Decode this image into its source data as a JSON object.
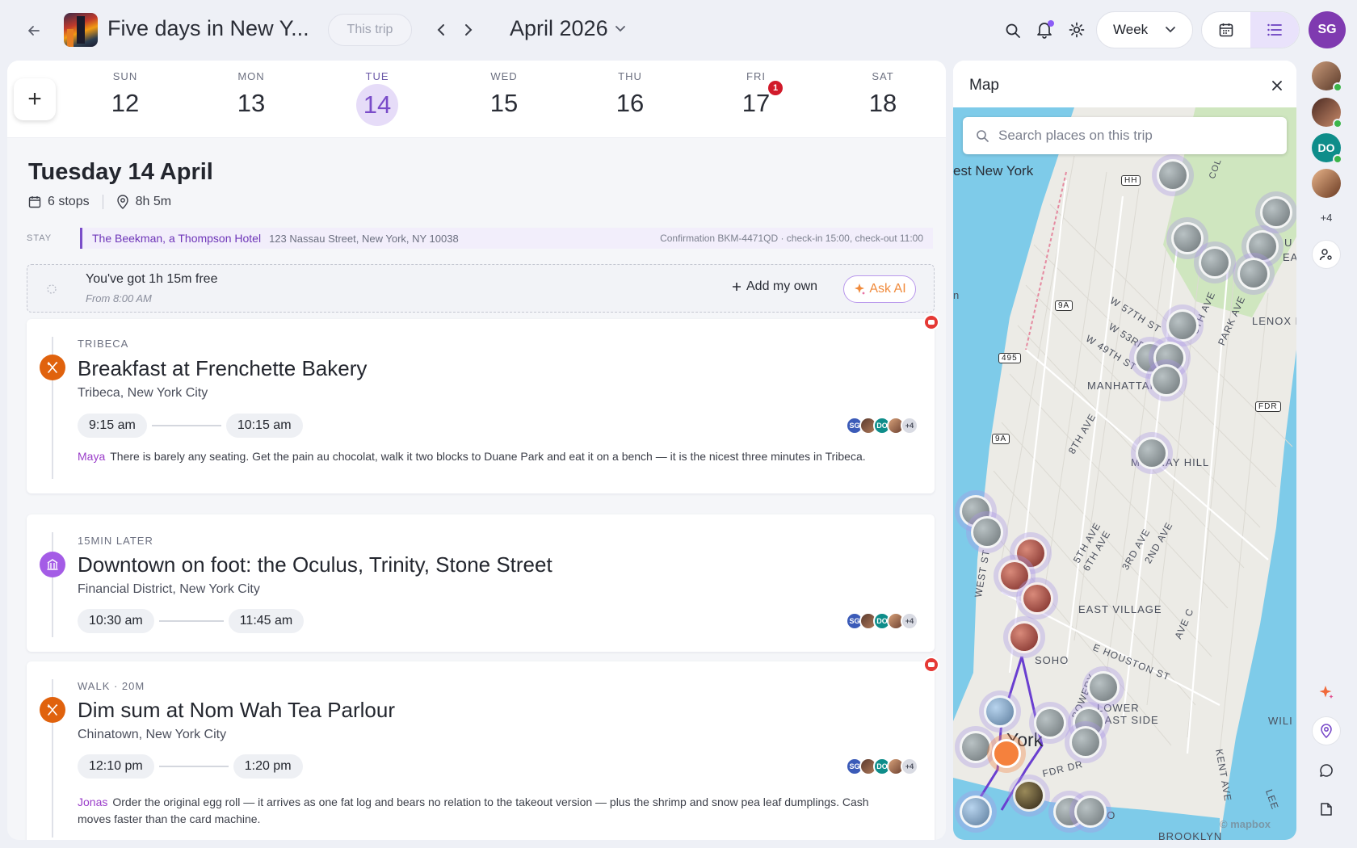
{
  "header": {
    "trip_title": "Five days in New Y...",
    "trip_filter": "This trip",
    "month": "April 2026",
    "view_mode": "Week",
    "user_initials": "SG"
  },
  "week": {
    "days": [
      {
        "dow": "SUN",
        "num": "12"
      },
      {
        "dow": "MON",
        "num": "13"
      },
      {
        "dow": "TUE",
        "num": "14",
        "active": true
      },
      {
        "dow": "WED",
        "num": "15"
      },
      {
        "dow": "THU",
        "num": "16"
      },
      {
        "dow": "FRI",
        "num": "17",
        "badge": "1"
      },
      {
        "dow": "SAT",
        "num": "18"
      }
    ]
  },
  "day": {
    "title": "Tuesday 14 April",
    "stops": "6 stops",
    "duration": "8h 5m"
  },
  "stay": {
    "label": "STAY",
    "name": "The Beekman, a Thompson Hotel",
    "address": "123 Nassau Street, New York, NY 10038",
    "confirmation": "Confirmation BKM-4471QD · check-in 15:00, check-out 11:00"
  },
  "free": {
    "title": "You've got 1h 15m free",
    "subtitle": "From 8:00 AM",
    "add_own": "Add my own",
    "ask_ai": "Ask AI"
  },
  "events": [
    {
      "eyebrow": "TRIBECA",
      "title": "Breakfast at Frenchette Bakery",
      "location": "Tribeca, New York City",
      "start": "9:15 am",
      "end": "10:15 am",
      "note_author": "Maya",
      "note": "There is barely any seating. Get the pain au chocolat, walk it two blocks to Duane Park and eat it on a bench — it is the nicest three minutes in Tribeca.",
      "icon": "fork-knife-icon",
      "icon_color": "#e0620d"
    },
    {
      "eyebrow": "15MIN LATER",
      "title": "Downtown on foot: the Oculus, Trinity, Stone Street",
      "location": "Financial District, New York City",
      "start": "10:30 am",
      "end": "11:45 am",
      "icon": "landmark-icon",
      "icon_color": "#a45ce6"
    },
    {
      "eyebrow": "WALK · 20M",
      "title": "Dim sum at Nom Wah Tea Parlour",
      "location": "Chinatown, New York City",
      "start": "12:10 pm",
      "end": "1:20 pm",
      "note_author": "Jonas",
      "note": "Order the original egg roll — it arrives as one fat log and bears no relation to the takeout version — plus the shrimp and snow pea leaf dumplings. Cash moves faster than the card machine.",
      "icon": "fork-knife-icon",
      "icon_color": "#e0620d"
    }
  ],
  "attendees": {
    "sg": "SG",
    "do": "DO",
    "more": "+4"
  },
  "map": {
    "title": "Map",
    "search_placeholder": "Search places on this trip",
    "labels": {
      "west_ny": "est New York",
      "manhattan": "MANHATTAN",
      "murray_hill": "MURRAY HILL",
      "east_village": "EAST VILLAGE",
      "soho": "SOHO",
      "lower_east_side": "LOWER\nEAST SIDE",
      "york": "York",
      "dumbo": "DUMBO",
      "brooklyn": "BROOKLYN",
      "lenox": "LENOX H",
      "w57": "W 57TH ST",
      "w53": "W 53RD",
      "w49": "W 49TH ST",
      "ave8": "8TH AVE",
      "ave6": "6TH AVE",
      "ave5": "5TH AVE",
      "ave3": "3RD AVE",
      "ave2": "2ND AVE",
      "west_st": "WEST ST",
      "houston": "E HOUSTON ST",
      "bowery": "BOWERY",
      "fdr_dr": "FDR DR",
      "kent": "KENT AVE",
      "park": "PARK AVE",
      "fifth": "5TH AVE",
      "avec": "AVE C",
      "hh": "HH",
      "r9a": "9A",
      "r495": "495",
      "fdr": "FDR",
      "wil": "WILI",
      "ea": "EAS",
      "u": "U",
      "col": "COL",
      "n": "n",
      "lee": "LEE"
    },
    "attribution": "© mapbox"
  },
  "rail": {
    "do_initials": "DO",
    "more": "+4"
  }
}
